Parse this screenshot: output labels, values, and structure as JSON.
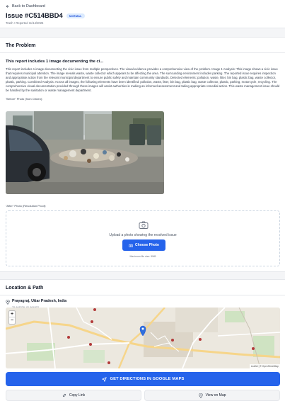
{
  "header": {
    "back_label": "Back to Dashboard",
    "issue_title": "Issue #C514BBD4",
    "status_badge": "NORMAL",
    "meta": "Trash • Reported 11/14/2025"
  },
  "problem": {
    "section_title": "The Problem",
    "subtitle": "This report includes 1 image documenting the ci...",
    "description": "This report includes 1 image documenting the civic issue from multiple perspectives. The visual evidence provides a comprehensive view of the problem. Image 1 Analysis: This image shows a civic issue that requires municipal attention. The image reveals waste, waste collector which appears to be affecting the area. The surrounding environment includes parking. The reported issue requires inspection and appropriate action from the relevant municipal department to ensure public safety and maintain community standards. Detected elements: pollution, waste, litter, bin bag, plastic bag, waste collector, plastic, parking. Combined Analysis: Across all images, the following elements have been identified: pollution, waste, litter, bin bag, plastic bag, waste collector, plastic, parking, motorcycle, recycling. The comprehensive visual documentation provided through these images will assist authorities in making an informed assessment and taking appropriate remedial action. This waste management issue should be handled by the sanitation or waste management department.",
    "before_label": "\"Before\" Photo (from Citizen):",
    "after_label": "\"After\" Photo (Resolution Proof):",
    "upload_text": "Upload a photo showing the resolved issue",
    "choose_label": "Choose Photo",
    "max_size": "Maximum file size: 5MB"
  },
  "location": {
    "section_title": "Location & Path",
    "place": "Prayagraj, Uttar Pradesh, India",
    "coords": "25.468339, 81.864802",
    "zoom_in": "+",
    "zoom_out": "−",
    "attribution": "Leaflet | © OpenStreetMap",
    "directions_label": "GET DIRECTIONS IN GOOGLE MAPS",
    "copy_label": "Copy Link",
    "view_label": "View on Map"
  },
  "colors": {
    "accent": "#2563eb",
    "badge_bg": "#dbeafe",
    "badge_text": "#1d4ed8"
  },
  "icons": [
    "arrow-left-icon",
    "camera-icon",
    "location-pin-icon",
    "navigation-arrow-icon",
    "link-icon",
    "map-pin-icon"
  ]
}
